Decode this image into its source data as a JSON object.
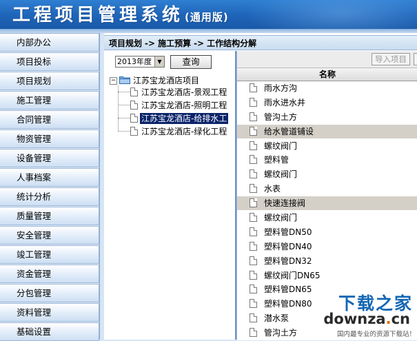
{
  "app": {
    "title": "工程项目管理系统",
    "edition": "(通用版)"
  },
  "nav": {
    "items": [
      {
        "label": "内部办公"
      },
      {
        "label": "项目投标"
      },
      {
        "label": "项目规划"
      },
      {
        "label": "施工管理"
      },
      {
        "label": "合同管理"
      },
      {
        "label": "物资管理"
      },
      {
        "label": "设备管理"
      },
      {
        "label": "人事档案"
      },
      {
        "label": "统计分析"
      },
      {
        "label": "质量管理"
      },
      {
        "label": "安全管理"
      },
      {
        "label": "竣工管理"
      },
      {
        "label": "资金管理"
      },
      {
        "label": "分包管理"
      },
      {
        "label": "资料管理"
      },
      {
        "label": "基础设置"
      }
    ]
  },
  "breadcrumb": {
    "items": [
      "项目规划",
      "施工预算",
      "工作结构分解"
    ],
    "separator": "->"
  },
  "filter": {
    "year_value": "2013年度",
    "query_label": "查询"
  },
  "tree": {
    "root_toggle": "−",
    "root_label": "江苏宝龙酒店项目",
    "children": [
      {
        "label": "江苏宝龙酒店-景观工程"
      },
      {
        "label": "江苏宝龙酒店-照明工程"
      },
      {
        "label": "江苏宝龙酒店-给排水工"
      },
      {
        "label": "江苏宝龙酒店-绿化工程"
      }
    ],
    "selected_index": 2
  },
  "list": {
    "import_label": "导入项目",
    "column_name": "名称",
    "rows": [
      {
        "name": "雨水方沟"
      },
      {
        "name": "雨水进水井"
      },
      {
        "name": "管沟土方"
      },
      {
        "name": "给水管道铺设"
      },
      {
        "name": "螺纹阀门"
      },
      {
        "name": "塑料管"
      },
      {
        "name": "螺纹阀门"
      },
      {
        "name": "水表"
      },
      {
        "name": "快速连接阀"
      },
      {
        "name": "螺纹阀门"
      },
      {
        "name": "塑料管DN50"
      },
      {
        "name": "塑料管DN40"
      },
      {
        "name": "塑料管DN32"
      },
      {
        "name": "螺纹阀门DN65"
      },
      {
        "name": "塑料管DN65"
      },
      {
        "name": "塑料管DN80"
      },
      {
        "name": "潜水泵"
      },
      {
        "name": "管沟土方"
      }
    ],
    "shaded_rows": [
      3,
      8
    ]
  },
  "watermark": {
    "brand": "下载之家",
    "site_prefix": "downza",
    "site_dot": ".",
    "site_suffix": "cn",
    "slogan": "国内最专业的资源下载站！"
  },
  "colors": {
    "header_blue": "#1e64b8",
    "selection_navy": "#0a246a",
    "row_shade": "#d4d0c8"
  }
}
